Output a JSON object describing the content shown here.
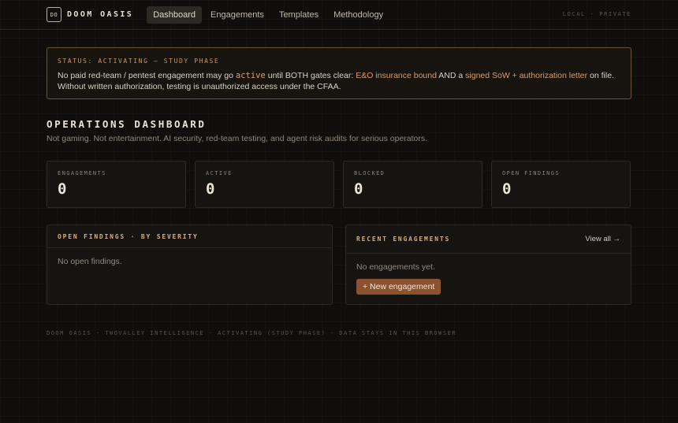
{
  "header": {
    "logo_mark": "DO",
    "logo_text": "DOOM OASIS",
    "nav": [
      {
        "label": "Dashboard",
        "active": true
      },
      {
        "label": "Engagements",
        "active": false
      },
      {
        "label": "Templates",
        "active": false
      },
      {
        "label": "Methodology",
        "active": false
      }
    ],
    "right_text": "LOCAL · PRIVATE"
  },
  "status": {
    "title": "STATUS: ACTIVATING — STUDY PHASE",
    "text_1": "No paid red-team / pentest engagement may go ",
    "text_active": "active",
    "text_2": " until BOTH gates clear: ",
    "text_gate1": "E&O insurance bound",
    "text_3": " AND a ",
    "text_gate2": "signed SoW + authorization letter",
    "text_4": " on file. Without written authorization, testing is unauthorized access under the CFAA."
  },
  "dashboard": {
    "title": "OPERATIONS DASHBOARD",
    "subtitle": "Not gaming. Not entertainment. AI security, red-team testing, and agent risk audits for serious operators."
  },
  "stats": [
    {
      "label": "ENGAGEMENTS",
      "value": "0"
    },
    {
      "label": "ACTIVE",
      "value": "0"
    },
    {
      "label": "BLOCKED",
      "value": "0"
    },
    {
      "label": "OPEN FINDINGS",
      "value": "0"
    }
  ],
  "findings_panel": {
    "title": "OPEN FINDINGS · BY SEVERITY",
    "empty": "No open findings."
  },
  "engagements_panel": {
    "title": "RECENT ENGAGEMENTS",
    "view_all": "View all →",
    "empty": "No engagements yet.",
    "new_button": "+ New engagement"
  },
  "footer": {
    "text": "DOOM OASIS · TWOVALLEY INTELLIGENCE · ACTIVATING (STUDY PHASE) · DATA STAYS IN THIS BROWSER"
  }
}
